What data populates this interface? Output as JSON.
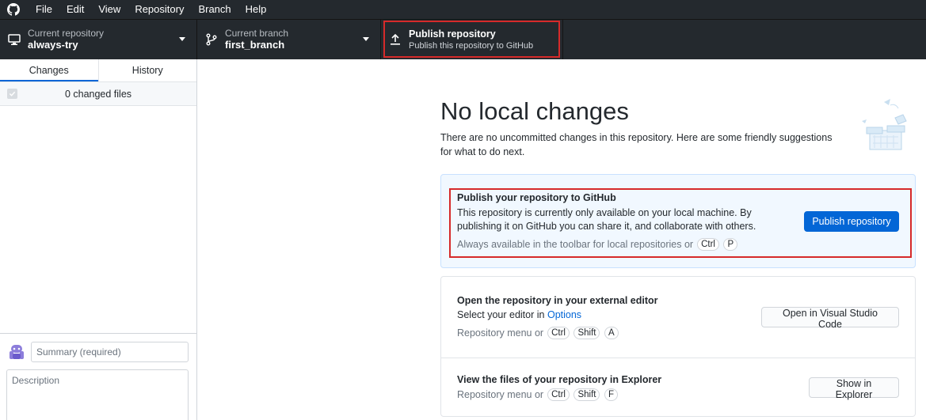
{
  "menubar": {
    "items": [
      "File",
      "Edit",
      "View",
      "Repository",
      "Branch",
      "Help"
    ]
  },
  "toolbar": {
    "repo": {
      "sub": "Current repository",
      "main": "always-try"
    },
    "branch": {
      "sub": "Current branch",
      "main": "first_branch"
    },
    "publish": {
      "main": "Publish repository",
      "sub": "Publish this repository to GitHub"
    }
  },
  "sidebar": {
    "tabs": [
      "Changes",
      "History"
    ],
    "changed_files": "0 changed files",
    "summary_placeholder": "Summary (required)",
    "description_placeholder": "Description"
  },
  "main": {
    "heading": "No local changes",
    "subtext": "There are no uncommitted changes in this repository. Here are some friendly suggestions for what to do next.",
    "publish_card": {
      "title": "Publish your repository to GitHub",
      "desc": "This repository is currently only available on your local machine. By publishing it on GitHub you can share it, and collaborate with others.",
      "hint_prefix": "Always available in the toolbar for local repositories or",
      "keys": [
        "Ctrl",
        "P"
      ],
      "button": "Publish repository"
    },
    "editor_card": {
      "title": "Open the repository in your external editor",
      "desc_prefix": "Select your editor in",
      "desc_link": "Options",
      "hint_prefix": "Repository menu or",
      "keys": [
        "Ctrl",
        "Shift",
        "A"
      ],
      "button": "Open in Visual Studio Code"
    },
    "explorer_card": {
      "title": "View the files of your repository in Explorer",
      "hint_prefix": "Repository menu or",
      "keys": [
        "Ctrl",
        "Shift",
        "F"
      ],
      "button": "Show in Explorer"
    }
  },
  "colors": {
    "toolbar_bg": "#24292e",
    "accent": "#0366d6",
    "highlight": "#d62a2a"
  }
}
